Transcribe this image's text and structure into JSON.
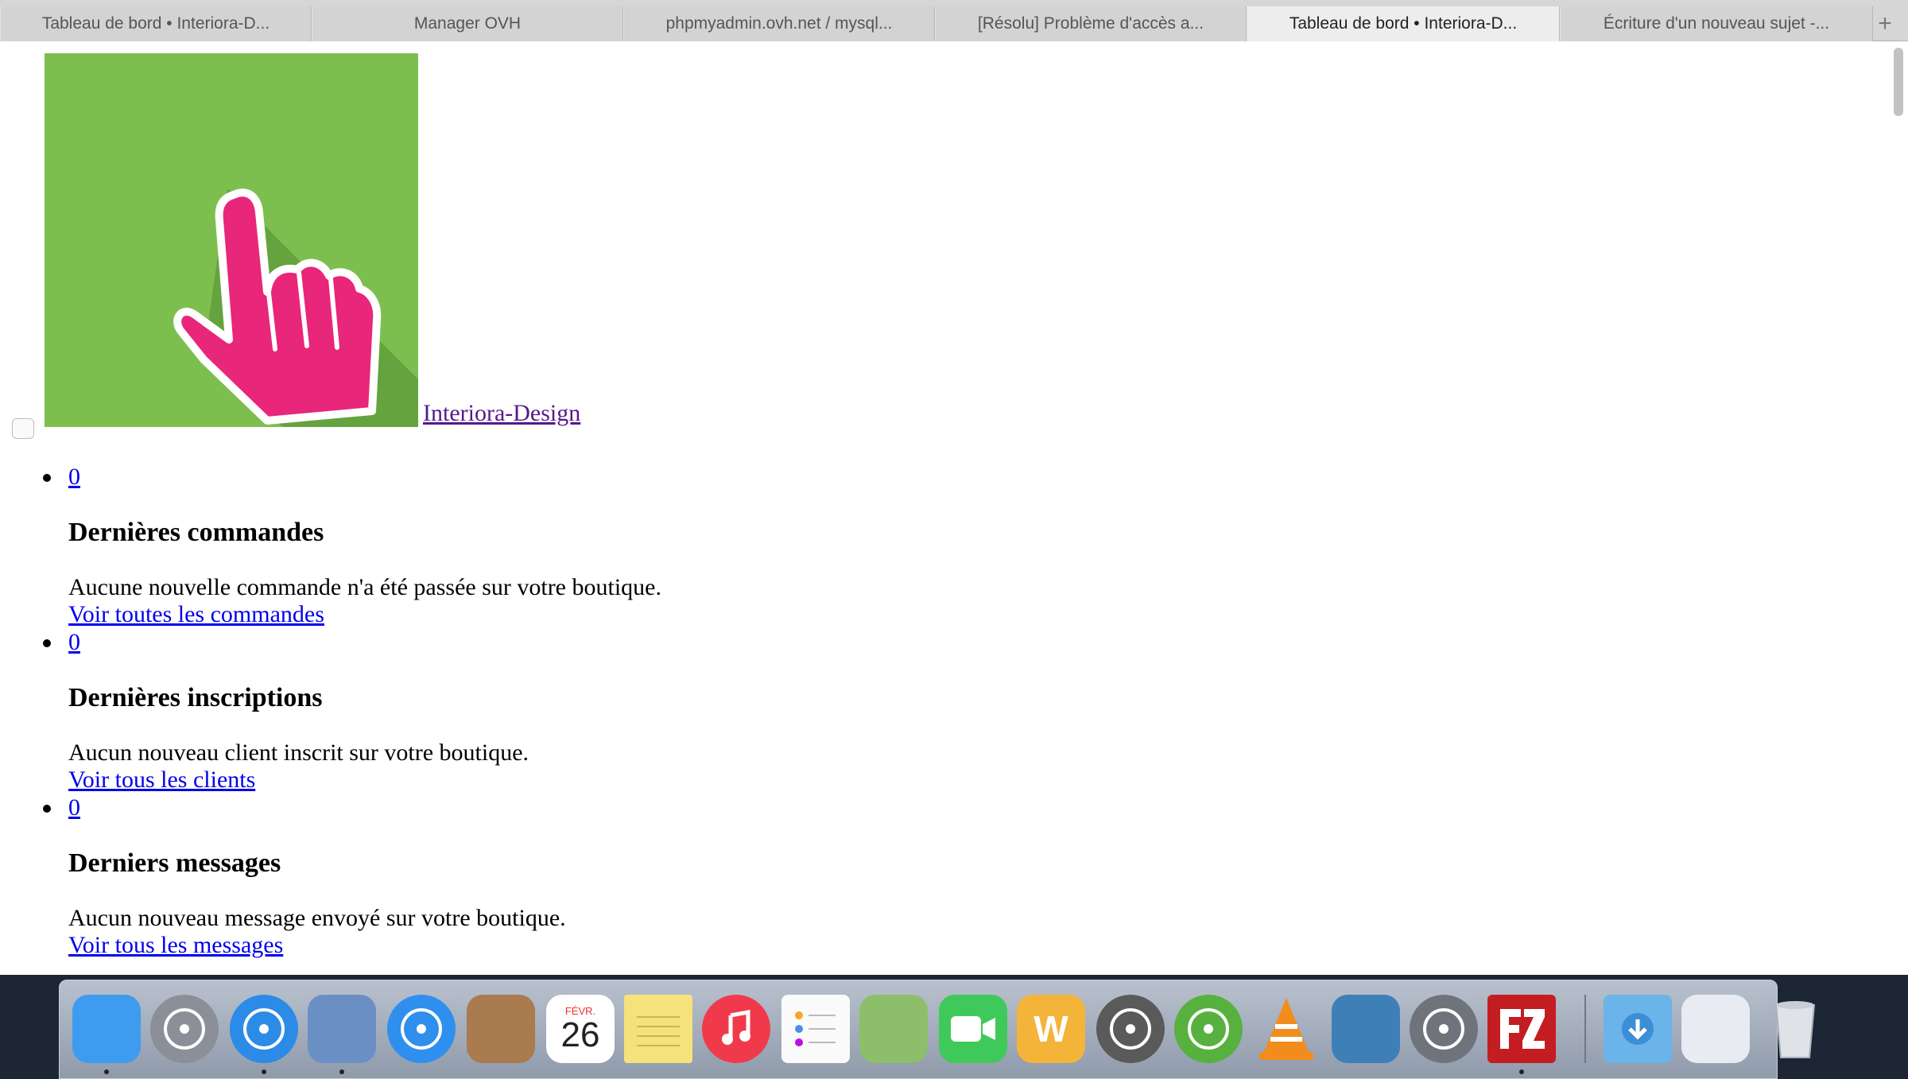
{
  "tabs": [
    {
      "label": "Tableau de bord • Interiora-D...",
      "active": false
    },
    {
      "label": "Manager OVH",
      "active": false
    },
    {
      "label": "phpmyadmin.ovh.net / mysql...",
      "active": false
    },
    {
      "label": "[Résolu] Problème d'accès a...",
      "active": false
    },
    {
      "label": "Tableau de bord • Interiora-D...",
      "active": true
    },
    {
      "label": "Écriture d'un nouveau sujet -...",
      "active": false
    }
  ],
  "new_tab_symbol": "+",
  "logo": {
    "text": "Interiora-Design"
  },
  "sections": [
    {
      "count": "0",
      "heading": "Dernières commandes",
      "message": "Aucune nouvelle commande n'a été passée sur votre boutique.",
      "link": "Voir toutes les commandes"
    },
    {
      "count": "0",
      "heading": "Dernières inscriptions",
      "message": "Aucun nouveau client inscrit sur votre boutique.",
      "link": "Voir tous les clients"
    },
    {
      "count": "0",
      "heading": "Derniers messages",
      "message": "Aucun nouveau message envoyé sur votre boutique.",
      "link": "Voir tous les messages"
    }
  ],
  "dock": {
    "calendar_month": "FÉVR.",
    "calendar_day": "26",
    "apps": [
      {
        "name": "finder-icon",
        "color": "#3d9cf0"
      },
      {
        "name": "launchpad-icon",
        "color": "#8a8f98"
      },
      {
        "name": "safari-icon",
        "color": "#2b8be6"
      },
      {
        "name": "mail-icon",
        "color": "#6a8fc4"
      },
      {
        "name": "app-store-icon",
        "color": "#2e8fee"
      },
      {
        "name": "contacts-icon",
        "color": "#a97b4f"
      },
      {
        "name": "calendar-icon",
        "color": "#ffffff"
      },
      {
        "name": "notes-icon",
        "color": "#f5e27a"
      },
      {
        "name": "itunes-icon",
        "color": "#f03a4c"
      },
      {
        "name": "reminders-icon",
        "color": "#fafafa"
      },
      {
        "name": "maps-icon",
        "color": "#8dbf6b"
      },
      {
        "name": "facetime-icon",
        "color": "#3fc95a"
      },
      {
        "name": "wunderlist-icon",
        "color": "#f4b43a"
      },
      {
        "name": "macpaw-icon",
        "color": "#5a5a5a"
      },
      {
        "name": "utorrent-icon",
        "color": "#56b13f"
      },
      {
        "name": "vlc-icon",
        "color": "#f28c1c"
      },
      {
        "name": "image-capture-icon",
        "color": "#3f7fb8"
      },
      {
        "name": "system-preferences-icon",
        "color": "#6f747b"
      },
      {
        "name": "filezilla-icon",
        "color": "#c31d22"
      },
      {
        "name": "downloads-folder-icon",
        "color": "#6ab4ea"
      },
      {
        "name": "screenshot-stack-icon",
        "color": "#e8ecf2"
      },
      {
        "name": "trash-icon",
        "color": "#d9dde3"
      }
    ]
  }
}
